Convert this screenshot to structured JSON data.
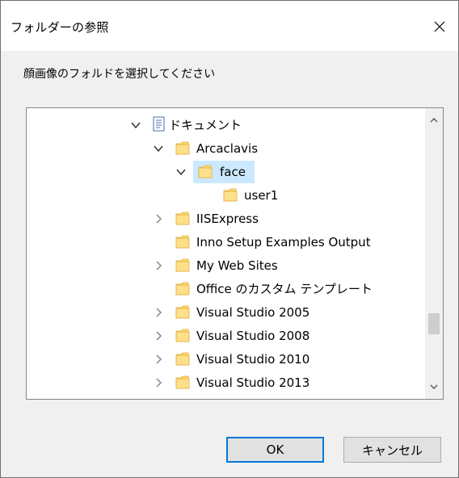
{
  "window": {
    "title": "フォルダーの参照",
    "close_label": "×"
  },
  "instruction": "顔画像のフォルドを選択してください",
  "tree": {
    "items": [
      {
        "label": "ドキュメント",
        "expanded": true,
        "has_children": true,
        "icon": "documents-icon"
      },
      {
        "label": "Arcaclavis",
        "expanded": true,
        "has_children": true,
        "icon": "folder-icon"
      },
      {
        "label": "face",
        "expanded": true,
        "has_children": true,
        "icon": "folder-icon",
        "selected": true
      },
      {
        "label": "user1",
        "expanded": false,
        "has_children": false,
        "icon": "folder-icon"
      },
      {
        "label": "IISExpress",
        "expanded": false,
        "has_children": true,
        "icon": "folder-icon"
      },
      {
        "label": "Inno Setup Examples Output",
        "expanded": false,
        "has_children": false,
        "icon": "folder-icon"
      },
      {
        "label": "My Web Sites",
        "expanded": false,
        "has_children": true,
        "icon": "folder-icon"
      },
      {
        "label": "Office のカスタム テンプレート",
        "expanded": false,
        "has_children": false,
        "icon": "folder-icon"
      },
      {
        "label": "Visual Studio 2005",
        "expanded": false,
        "has_children": true,
        "icon": "folder-icon"
      },
      {
        "label": "Visual Studio 2008",
        "expanded": false,
        "has_children": true,
        "icon": "folder-icon"
      },
      {
        "label": "Visual Studio 2010",
        "expanded": false,
        "has_children": true,
        "icon": "folder-icon"
      },
      {
        "label": "Visual Studio 2013",
        "expanded": false,
        "has_children": true,
        "icon": "folder-icon"
      }
    ]
  },
  "buttons": {
    "ok_label": "OK",
    "cancel_label": "キャンセル"
  },
  "colors": {
    "selection": "#cce8ff",
    "folder": "#ffd967",
    "ok_border": "#0078d7"
  }
}
